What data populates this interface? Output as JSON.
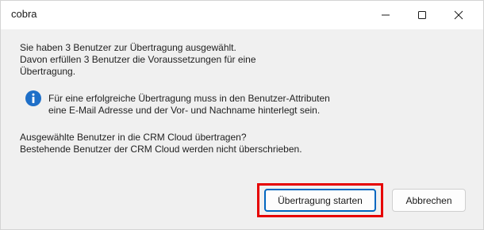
{
  "window": {
    "title": "cobra",
    "controls": {
      "minimize_icon": "minimize-icon",
      "maximize_icon": "maximize-icon",
      "close_icon": "close-icon"
    }
  },
  "message": {
    "intro_lines": [
      "Sie haben 3 Benutzer zur Übertragung ausgewählt.",
      "Davon erfüllen 3 Benutzer die Voraussetzungen für eine",
      "Übertragung."
    ],
    "info_lines": [
      "Für eine erfolgreiche Übertragung muss in den Benutzer-Attributen",
      "eine E-Mail Adresse und der Vor- und Nachname hinterlegt sein."
    ],
    "question_lines": [
      "Ausgewählte Benutzer in die CRM Cloud übertragen?",
      "Bestehende Benutzer der CRM Cloud werden nicht überschrieben."
    ],
    "info_icon": "info-icon"
  },
  "buttons": {
    "start_label": "Übertragung starten",
    "cancel_label": "Abbrechen"
  },
  "colors": {
    "accent": "#0067c0",
    "info_icon": "#1e6fc8",
    "highlight": "#e60000",
    "background": "#f0f0f0"
  }
}
